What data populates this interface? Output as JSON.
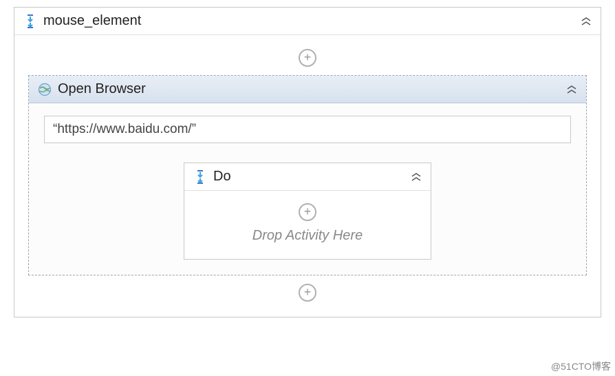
{
  "sequence": {
    "title": "mouse_element"
  },
  "openBrowser": {
    "title": "Open Browser",
    "url": "“https://www.baidu.com/”"
  },
  "doBlock": {
    "title": "Do",
    "placeholder": "Drop Activity Here"
  },
  "watermark": "@51CTO博客"
}
